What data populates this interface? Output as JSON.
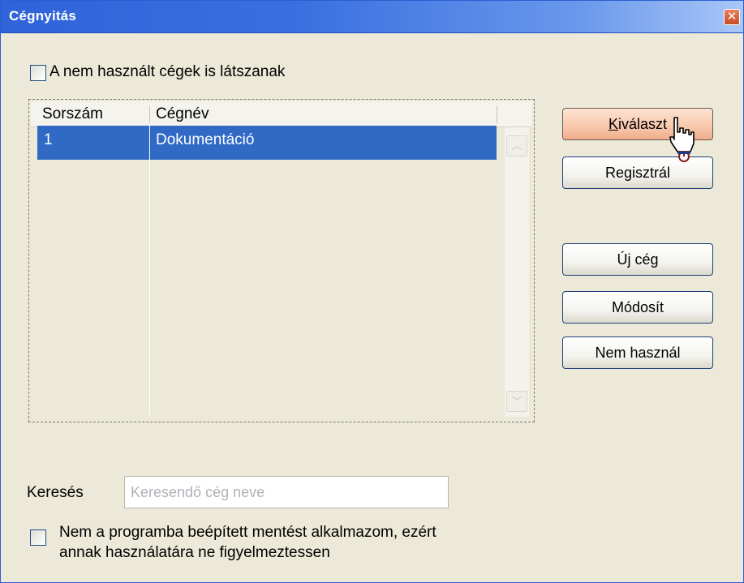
{
  "window": {
    "title": "Cégnyitás"
  },
  "show_unused_checkbox": {
    "label": "A nem használt cégek is látszanak",
    "checked": false
  },
  "company_table": {
    "columns": [
      "Sorszám",
      "Cégnév"
    ],
    "rows": [
      {
        "number": "1",
        "name": "Dokumentáció",
        "selected": true
      }
    ]
  },
  "buttons": {
    "select_label": "Kiválaszt",
    "select_mnemonic": "K",
    "select_rest": "iválaszt",
    "register_label": "Regisztrál",
    "new_company_label": "Új cég",
    "modify_label": "Módosít",
    "disable_label": "Nem használ"
  },
  "search": {
    "label": "Keresés",
    "placeholder": "Keresendő cég neve",
    "value": ""
  },
  "backup_warning_checkbox": {
    "label_line1": "Nem a programba beépített mentést alkalmazom, ezért",
    "label_line2": "annak használatára ne figyelmeztessen",
    "checked": false
  },
  "colors": {
    "titlebar": "#2f63d8",
    "selection": "#316ac5",
    "hot_button": "#f8c7ab",
    "dialog_bg": "#ece9d8"
  }
}
